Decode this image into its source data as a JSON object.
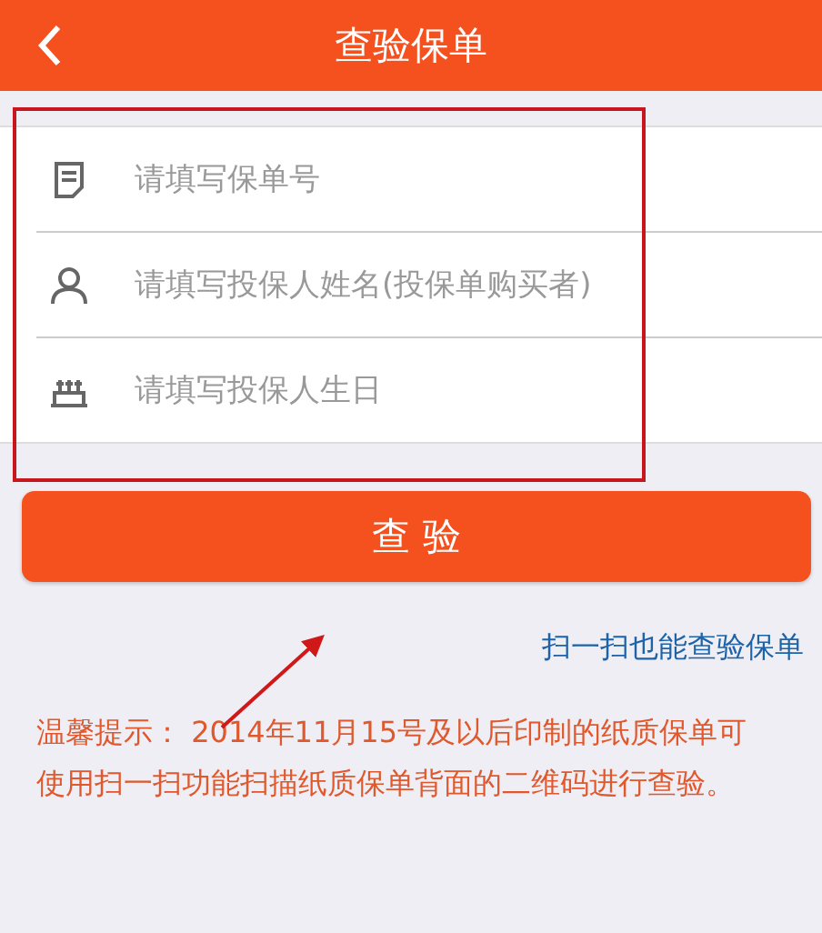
{
  "header": {
    "title": "查验保单"
  },
  "fields": [
    {
      "kind": "document",
      "placeholder": "请填写保单号"
    },
    {
      "kind": "person",
      "placeholder": "请填写投保人姓名(投保单购买者)"
    },
    {
      "kind": "cake",
      "placeholder": "请填写投保人生日"
    }
  ],
  "submit": "查 验",
  "scan_link": "扫一扫也能查验保单",
  "notice": "温馨提示： 2014年11月15号及以后印制的纸质保单可使用扫一扫功能扫描纸质保单背面的二维码进行查验。"
}
